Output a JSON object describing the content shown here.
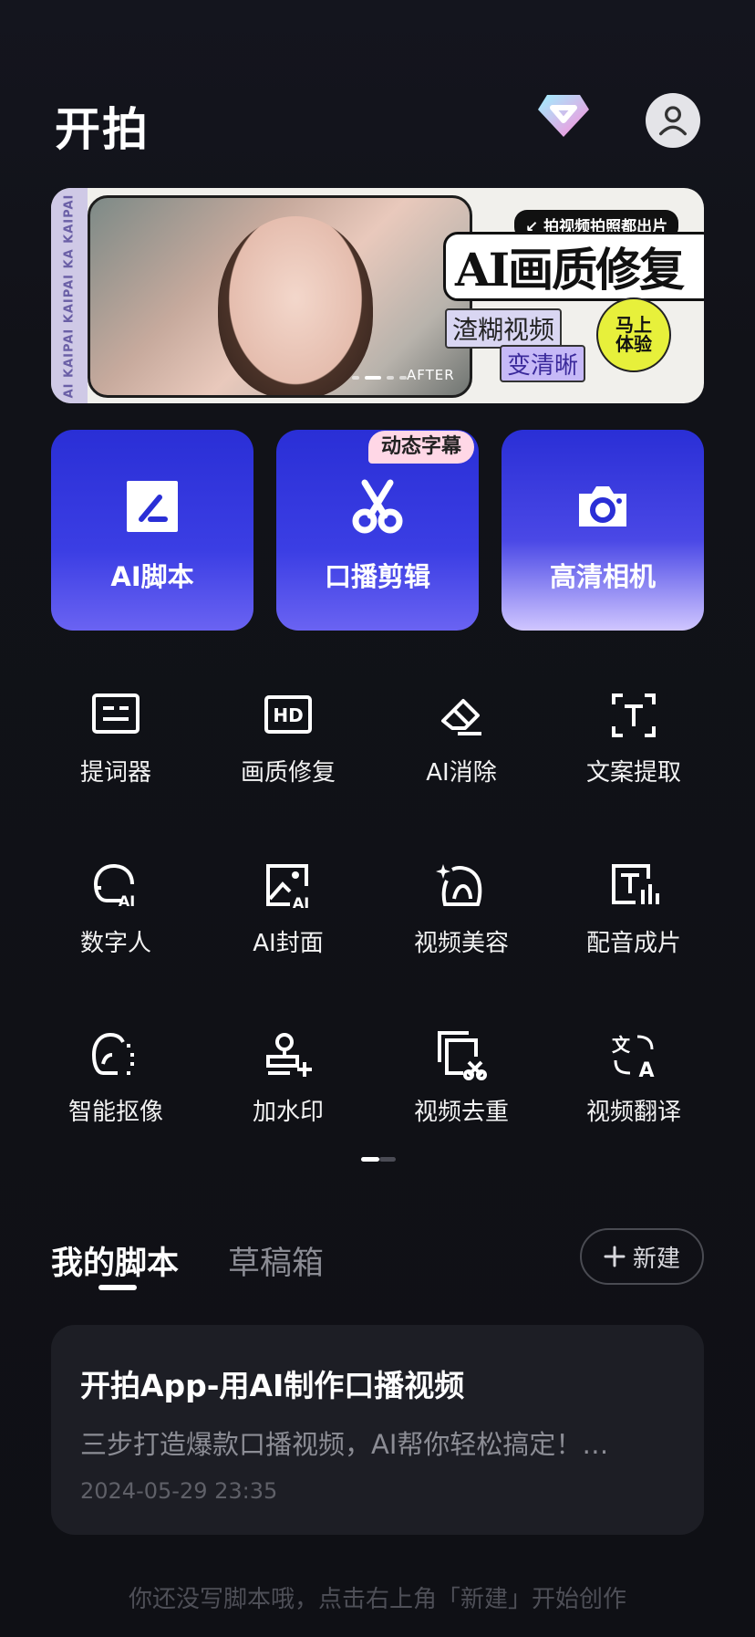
{
  "header": {
    "title": "开拍"
  },
  "banner": {
    "strip_text": "AI KAIPAI KAIPAI KA KAIPAI",
    "after_label": "AFTER",
    "tag_top": "↙ 拍视频拍照都出片",
    "headline": "AI画质修复",
    "tag_blurry": "渣糊视频",
    "tag_clear": "变清晰",
    "seal": "马上\n体验",
    "page_count": 4,
    "active_page": 2
  },
  "features": [
    {
      "label": "AI脚本",
      "icon": "edit-square-icon"
    },
    {
      "label": "口播剪辑",
      "icon": "scissors-icon",
      "badge": "动态字幕"
    },
    {
      "label": "高清相机",
      "icon": "camera-icon"
    }
  ],
  "tools": [
    {
      "label": "提词器",
      "icon": "teleprompter-icon"
    },
    {
      "label": "画质修复",
      "icon": "hd-icon"
    },
    {
      "label": "AI消除",
      "icon": "eraser-icon"
    },
    {
      "label": "文案提取",
      "icon": "text-extract-icon"
    },
    {
      "label": "数字人",
      "icon": "digital-human-icon"
    },
    {
      "label": "AI封面",
      "icon": "ai-cover-icon"
    },
    {
      "label": "视频美容",
      "icon": "beauty-icon"
    },
    {
      "label": "配音成片",
      "icon": "dubbing-icon"
    },
    {
      "label": "智能抠像",
      "icon": "cutout-icon"
    },
    {
      "label": "加水印",
      "icon": "watermark-icon"
    },
    {
      "label": "视频去重",
      "icon": "dedupe-icon"
    },
    {
      "label": "视频翻译",
      "icon": "translate-icon"
    }
  ],
  "tabs": {
    "mine": "我的脚本",
    "drafts": "草稿箱",
    "new_button": "新建"
  },
  "card": {
    "title": "开拍App-用AI制作口播视频",
    "desc": "三步打造爆款口播视频，AI帮你轻松搞定！…",
    "time": "2024-05-29 23:35"
  },
  "footer": "你还没写脚本哦，点击右上角「新建」开始创作"
}
